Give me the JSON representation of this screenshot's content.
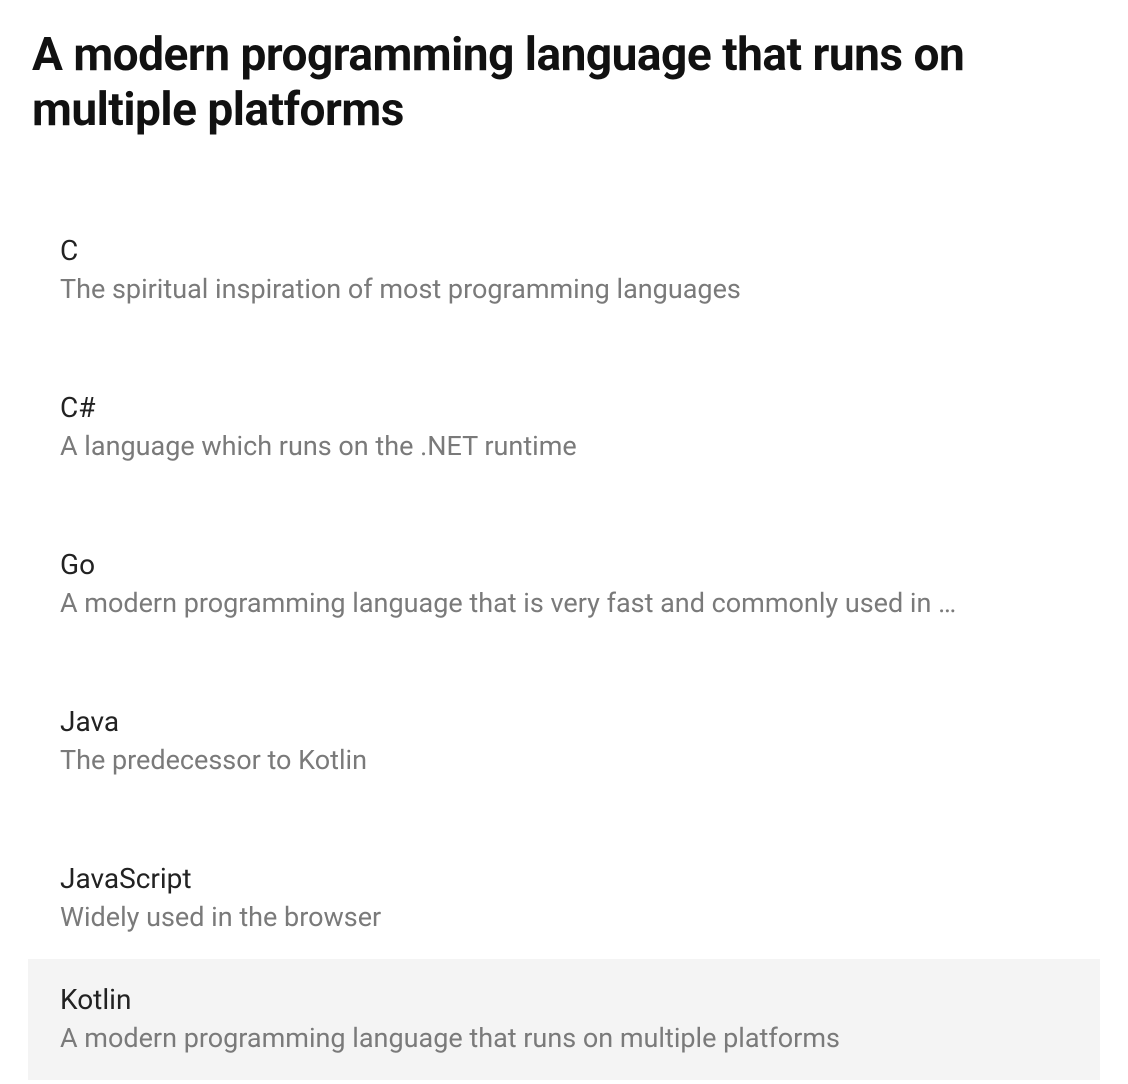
{
  "heading": "A modern programming language that runs on multiple platforms",
  "items": [
    {
      "title": "C",
      "desc": "The spiritual inspiration of most programming languages",
      "selected": false
    },
    {
      "title": "C#",
      "desc": "A language which runs on the .NET runtime",
      "selected": false
    },
    {
      "title": "Go",
      "desc": "A modern programming language that is very fast and commonly used in …",
      "selected": false
    },
    {
      "title": "Java",
      "desc": "The predecessor to Kotlin",
      "selected": false
    },
    {
      "title": "JavaScript",
      "desc": "Widely used in the browser",
      "selected": false
    },
    {
      "title": "Kotlin",
      "desc": "A modern programming language that runs on multiple platforms",
      "selected": true
    }
  ]
}
